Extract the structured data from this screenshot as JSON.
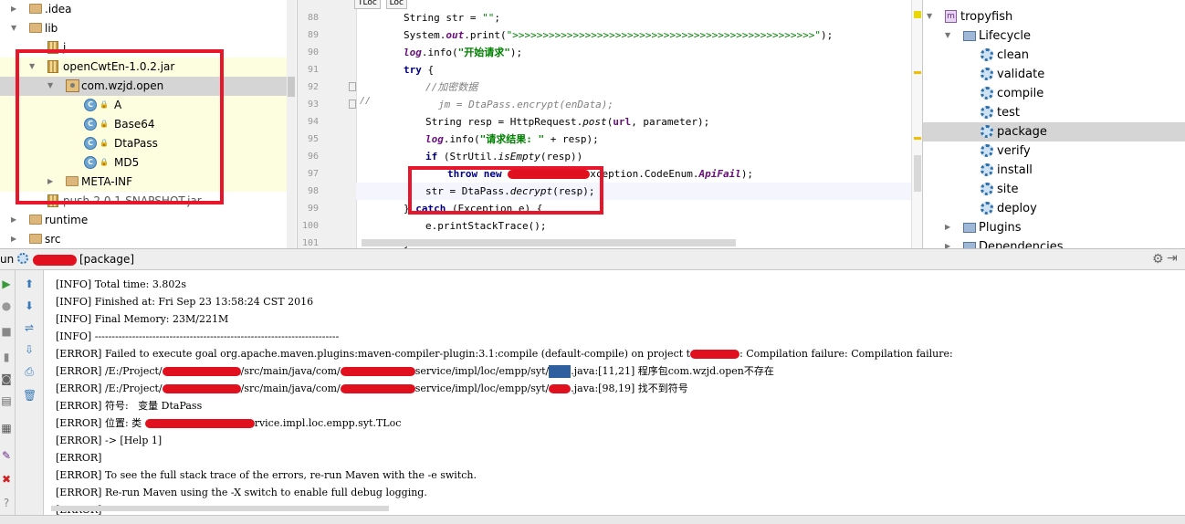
{
  "project_tree": {
    "items": [
      {
        "label": ".idea",
        "kind": "folder",
        "indent": 1,
        "arrow": "right"
      },
      {
        "label": "lib",
        "kind": "folder",
        "indent": 1,
        "arrow": "down"
      },
      {
        "label": "j",
        "kind": "jar",
        "indent": 2,
        "arrow": "none"
      },
      {
        "label": "openCwtEn-1.0.2.jar",
        "kind": "jar",
        "indent": 2,
        "arrow": "down"
      },
      {
        "label": "com.wzjd.open",
        "kind": "package",
        "indent": 3,
        "arrow": "down"
      },
      {
        "label": "A",
        "kind": "class",
        "indent": 4,
        "arrow": "none"
      },
      {
        "label": "Base64",
        "kind": "class",
        "indent": 4,
        "arrow": "none"
      },
      {
        "label": "DtaPass",
        "kind": "class",
        "indent": 4,
        "arrow": "none"
      },
      {
        "label": "MD5",
        "kind": "class",
        "indent": 4,
        "arrow": "none"
      },
      {
        "label": "META-INF",
        "kind": "folder",
        "indent": 3,
        "arrow": "right"
      },
      {
        "label": "push-2.0.1-SNAPSHOT.jar",
        "kind": "jar",
        "indent": 2,
        "arrow": "none"
      },
      {
        "label": "runtime",
        "kind": "folder",
        "indent": 1,
        "arrow": "right"
      },
      {
        "label": "src",
        "kind": "folder",
        "indent": 1,
        "arrow": "right"
      }
    ]
  },
  "editor": {
    "tabs": [
      "TLoc",
      "Loc"
    ],
    "line_numbers": [
      "88",
      "89",
      "90",
      "91",
      "92",
      "93",
      "94",
      "95",
      "96",
      "97",
      "98",
      "99",
      "100",
      "101"
    ]
  },
  "maven": {
    "project": "tropyfish",
    "lifecycle_label": "Lifecycle",
    "goals": [
      "clean",
      "validate",
      "compile",
      "test",
      "package",
      "verify",
      "install",
      "site",
      "deploy"
    ],
    "selected_goal": "package",
    "plugins_label": "Plugins",
    "dependencies_label": "Dependencies"
  },
  "run": {
    "prefix": "un",
    "target": "[package]",
    "output": [
      "[INFO] Total time: 3.802s",
      "[INFO] Finished at: Fri Sep 23 13:58:24 CST 2016",
      "[INFO] Final Memory: 23M/221M",
      "[INFO] ------------------------------------------------------------------------",
      "[ERROR] Failed to execute goal org.apache.maven.plugins:maven-compiler-plugin:3.1:compile (default-compile) on project t",
      "[ERROR] /E:/Project/",
      "[ERROR] /E:/Project/",
      "[ERROR] 符号:   变量 DtaPass",
      "[ERROR] 位置: 类 ",
      "[ERROR] -> [Help 1]",
      "[ERROR]",
      "[ERROR] To see the full stack trace of the errors, re-run Maven with the -e switch.",
      "[ERROR] Re-run Maven using the -X switch to enable full debug logging.",
      "[ERROR]"
    ],
    "frag": {
      "l4_tail": ": Compilation failure: Compilation failure:",
      "l5_mid": "/src/main/java/com/",
      "l5_mid2": "service/impl/loc/empp/syt/",
      "l5_tail": ".java:[11,21] 程序包com.wzjd.open不存在",
      "l6_tail": ".java:[98,19] 找不到符号",
      "l8_tail": "rvice.impl.loc.empp.syt.TLoc"
    }
  }
}
